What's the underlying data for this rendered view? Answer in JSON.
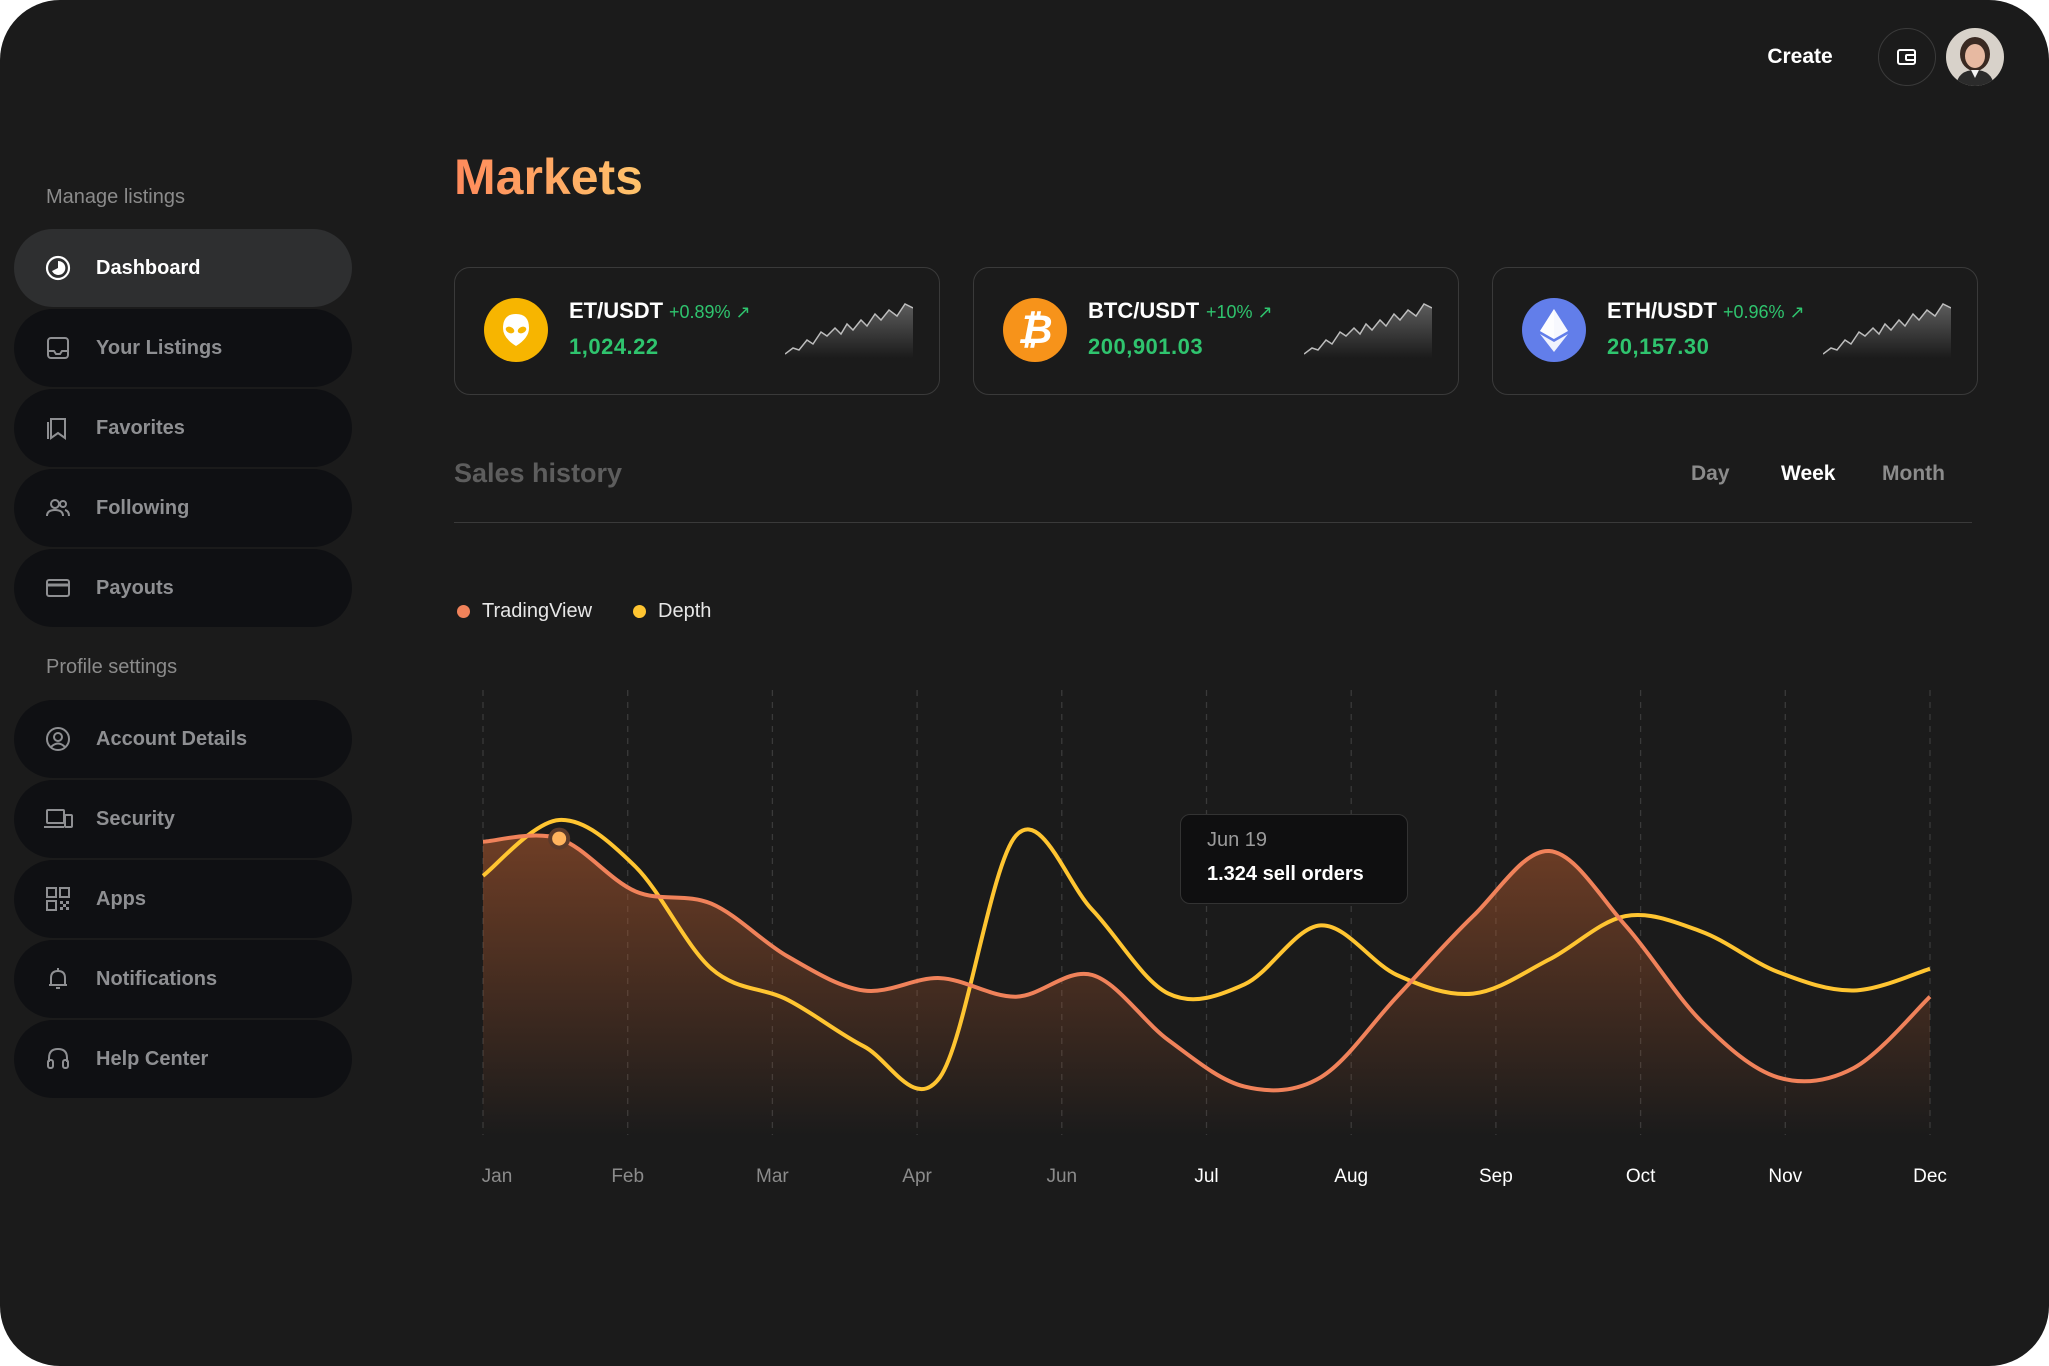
{
  "header": {
    "create_label": "Create",
    "wallet_icon": "wallet-icon",
    "avatar": "user-avatar"
  },
  "sidebar": {
    "manage_label": "Manage listings",
    "profile_label": "Profile settings",
    "manage_items": [
      {
        "label": "Dashboard",
        "icon": "pie-chart-icon",
        "active": true
      },
      {
        "label": "Your Listings",
        "icon": "inbox-icon"
      },
      {
        "label": "Favorites",
        "icon": "bookmark-icon"
      },
      {
        "label": "Following",
        "icon": "users-icon"
      },
      {
        "label": "Payouts",
        "icon": "credit-card-icon"
      }
    ],
    "profile_items": [
      {
        "label": "Account Details",
        "icon": "user-circle-icon"
      },
      {
        "label": "Security",
        "icon": "devices-icon"
      },
      {
        "label": "Apps",
        "icon": "qr-code-icon"
      },
      {
        "label": "Notifications",
        "icon": "bell-icon"
      },
      {
        "label": "Help Center",
        "icon": "headphones-icon"
      }
    ]
  },
  "main": {
    "title": "Markets",
    "cards": [
      {
        "pair": "ET/USDT",
        "change": "+0.89%",
        "price": "1,024.22",
        "icon": "alien-icon",
        "color": "#f7b500"
      },
      {
        "pair": "BTC/USDT",
        "change": "+10%",
        "price": "200,901.03",
        "icon": "bitcoin-icon",
        "color": "#f7931a"
      },
      {
        "pair": "ETH/USDT",
        "change": "+0.96%",
        "price": "20,157.30",
        "icon": "ethereum-icon",
        "color": "#627eea"
      }
    ],
    "sales_title": "Sales history",
    "tabs": [
      {
        "label": "Day",
        "active": false
      },
      {
        "label": "Week",
        "active": true
      },
      {
        "label": "Month",
        "active": false
      }
    ],
    "tooltip": {
      "date": "Jun 19",
      "value": "1.324 sell orders"
    }
  },
  "chart_data": {
    "type": "line",
    "categories": [
      "Jan",
      "Feb",
      "Mar",
      "Apr",
      "Jun",
      "Jul",
      "Aug",
      "Sep",
      "Oct",
      "Nov",
      "Dec"
    ],
    "series": [
      {
        "name": "TradingView",
        "color": "#f0825a",
        "values": [
          0.93,
          0.94,
          0.77,
          0.73,
          0.56,
          0.45,
          0.49,
          0.43,
          0.5,
          0.29,
          0.14,
          0.17,
          0.43,
          0.69,
          0.9,
          0.66,
          0.35,
          0.17,
          0.2,
          0.43
        ]
      },
      {
        "name": "Depth",
        "color": "#ffc531",
        "values": [
          0.82,
          1.0,
          0.85,
          0.52,
          0.42,
          0.27,
          0.17,
          0.95,
          0.71,
          0.44,
          0.47,
          0.66,
          0.5,
          0.44,
          0.55,
          0.69,
          0.64,
          0.51,
          0.45,
          0.52
        ]
      }
    ],
    "highlight": {
      "label": "Jun 19",
      "value": "1.324 sell orders"
    },
    "grid": true,
    "legend": "top-left"
  }
}
